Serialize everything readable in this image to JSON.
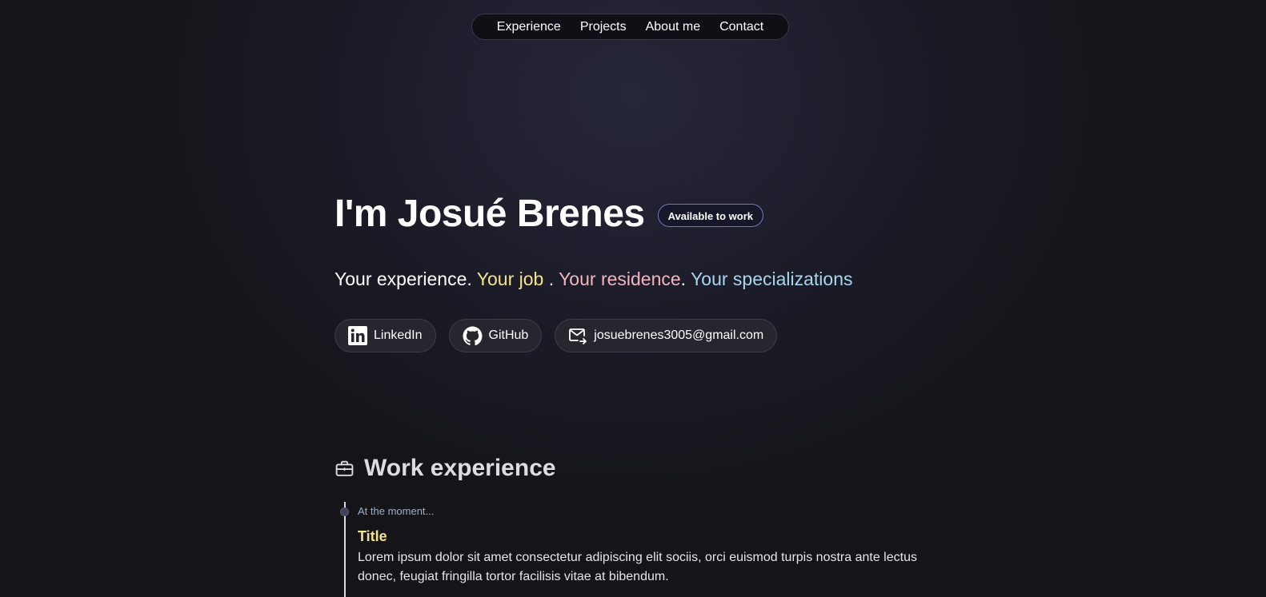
{
  "nav": {
    "items": [
      "Experience",
      "Projects",
      "About me",
      "Contact"
    ]
  },
  "hero": {
    "title": "I'm Josué Brenes",
    "badge": "Available to work",
    "tagline": {
      "part1": "Your experience. ",
      "job": "Your job",
      "sep": " . ",
      "residence": "Your residence",
      "sep2": ". ",
      "specializations": "Your specializations"
    },
    "links": {
      "linkedin": "LinkedIn",
      "github": "GitHub",
      "email": "josuebrenes3005@gmail.com"
    }
  },
  "experience": {
    "heading": "Work experience",
    "items": [
      {
        "date": "At the moment...",
        "title": "Title",
        "description": "Lorem ipsum dolor sit amet consectetur adipiscing elit sociis, orci euismod turpis nostra ante lectus donec, feugiat fringilla tortor facilisis vitae at bibendum."
      }
    ]
  },
  "colors": {
    "accent_job": "#f4e38a",
    "accent_residence": "#f3b5be",
    "accent_specializations": "#a7d6ef",
    "badge_border": "#7474c8"
  },
  "icons": [
    "linkedin-icon",
    "github-icon",
    "mail-icon",
    "briefcase-icon"
  ]
}
